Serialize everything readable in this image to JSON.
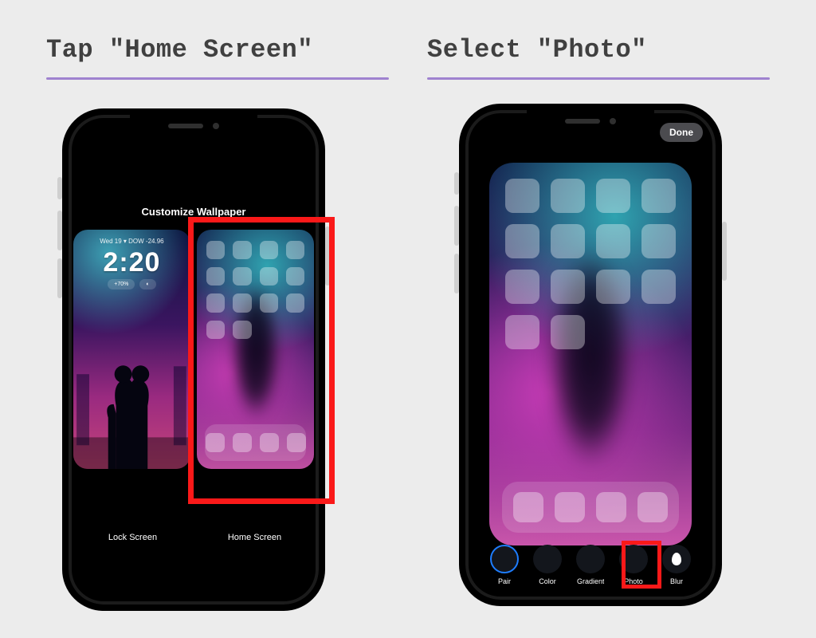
{
  "step1": {
    "title": "Tap \"Home Screen\"",
    "header": "Customize Wallpaper",
    "lock_label": "Lock Screen",
    "home_label": "Home Screen",
    "ls_topline": "Wed 19 ▾ DOW -24.96",
    "ls_clock": "2:20"
  },
  "step2": {
    "title": "Select \"Photo\"",
    "done": "Done",
    "options": {
      "pair": "Pair",
      "color": "Color",
      "gradient": "Gradient",
      "photo": "Photo",
      "blur": "Blur"
    }
  }
}
